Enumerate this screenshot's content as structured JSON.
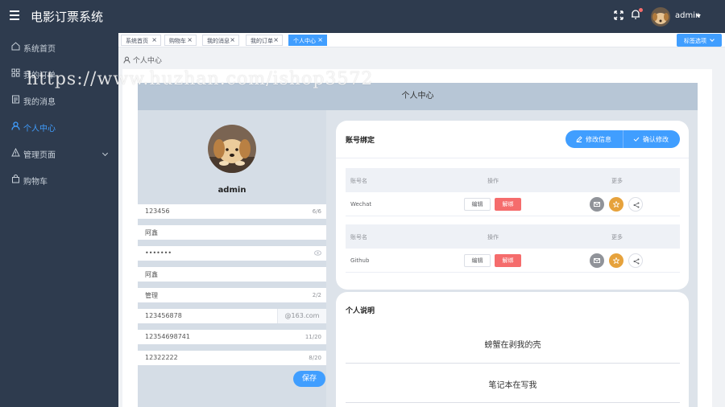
{
  "header": {
    "brand": "电影订票系统",
    "username": "admin"
  },
  "sidebar": {
    "items": [
      {
        "label": "系统首页",
        "icon": "home-icon"
      },
      {
        "label": "我的订单",
        "icon": "grid-icon"
      },
      {
        "label": "我的消息",
        "icon": "note-icon"
      },
      {
        "label": "个人中心",
        "icon": "user-icon",
        "active": true
      },
      {
        "label": "管理页面",
        "icon": "warning-icon"
      },
      {
        "label": "购物车",
        "icon": "bag-icon"
      }
    ]
  },
  "tabs": {
    "items": [
      "系统首页",
      "购物车",
      "我的消息",
      "我的订单",
      "个人中心"
    ],
    "close": "×",
    "options_label": "标签选项"
  },
  "breadcrumb": "个人中心",
  "page": {
    "banner_title": "个人中心"
  },
  "profile": {
    "name": "admin",
    "fields": {
      "f1_value": "123456",
      "f1_count": "6/6",
      "f2_value": "阿鑫",
      "f3_value": "•••••••",
      "f4_value": "阿鑫",
      "f5_value": "管理",
      "f5_count": "2/2",
      "f6_value": "123456878",
      "f6_suffix": "@163.com",
      "f7_value": "12354698741",
      "f7_count": "11/20",
      "f8_value": "12322222",
      "f8_count": "8/20"
    },
    "save_label": "保存"
  },
  "binding": {
    "title": "账号绑定",
    "edit_info_label": "修改信息",
    "confirm_label": "确认修改",
    "col_name": "账号名",
    "col_action": "操作",
    "col_more": "更多",
    "edit_label": "编辑",
    "unbind_label": "解绑",
    "rows": [
      "Wechat",
      "Github"
    ]
  },
  "about": {
    "title": "个人说明",
    "line1": "螃蟹在剥我的壳",
    "line2": "笔记本在写我"
  },
  "watermark": "https://www.huzhan.com/ishop3572",
  "colors": {
    "sidebar_bg": "#2e3b4e",
    "accent": "#409eff",
    "danger": "#f56c6c",
    "warning": "#e6a23c"
  }
}
